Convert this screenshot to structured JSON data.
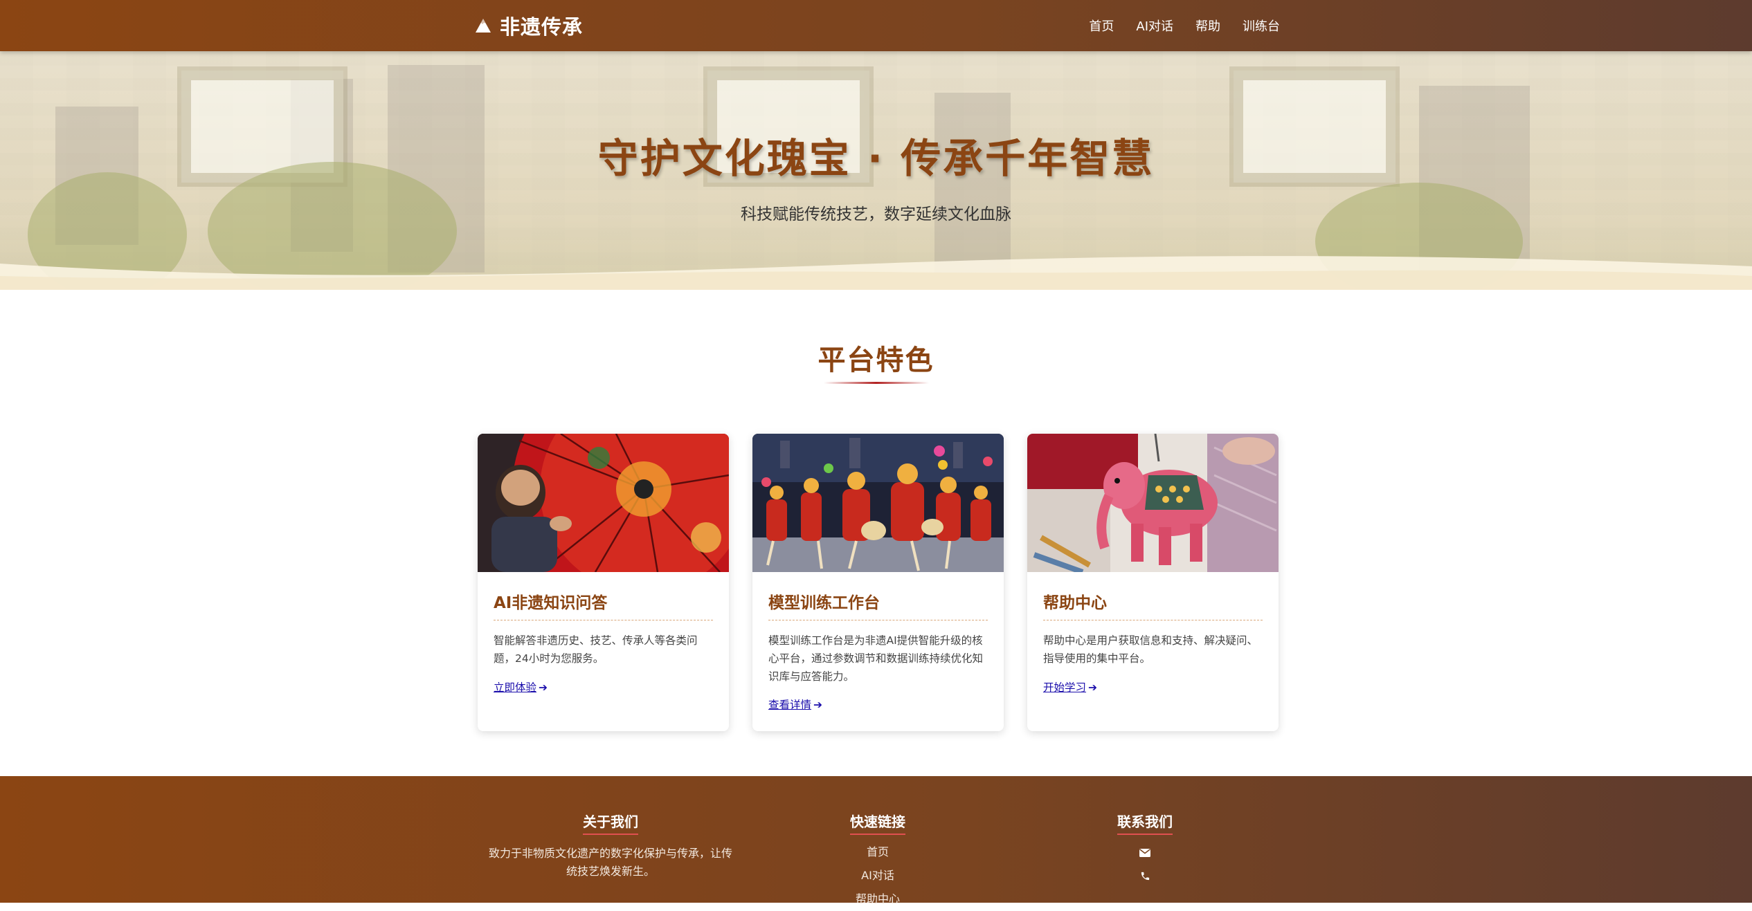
{
  "nav": {
    "brand": "非遗传承",
    "brand_icon": "mountain-icon",
    "links": [
      "首页",
      "AI对话",
      "帮助",
      "训练台"
    ]
  },
  "hero": {
    "title": "守护文化瑰宝 · 传承千年智慧",
    "subtitle": "科技赋能传统技艺，数字延续文化血脉"
  },
  "features": {
    "title": "平台特色",
    "cards": [
      {
        "title": "AI非遗知识问答",
        "text": "智能解答非遗历史、技艺、传承人等各类问题，24小时为您服务。",
        "link": "立即体验",
        "image": "red-paper-umbrella-craftsman"
      },
      {
        "title": "模型训练工作台",
        "text": "模型训练工作台是为非遗AI提供智能升级的核心平台，通过参数调节和数据训练持续优化知识库与应答能力。",
        "link": "查看详情",
        "image": "traditional-folk-dance-performance"
      },
      {
        "title": "帮助中心",
        "text": "帮助中心是用户获取信息和支持、解决疑问、指导使用的集中平台。",
        "link": "开始学习",
        "image": "painted-shadow-puppet-elephant"
      }
    ]
  },
  "footer": {
    "about": {
      "heading": "关于我们",
      "text": "致力于非物质文化遗产的数字化保护与传承，让传统技艺焕发新生。"
    },
    "links": {
      "heading": "快速链接",
      "items": [
        "首页",
        "AI对话",
        "帮助中心"
      ]
    },
    "contact": {
      "heading": "联系我们",
      "icons": [
        "envelope-icon",
        "phone-icon"
      ]
    }
  },
  "colors": {
    "brand_brown": "#8B4513",
    "accent_red": "#b22222",
    "link_blue": "#1a0dab"
  }
}
